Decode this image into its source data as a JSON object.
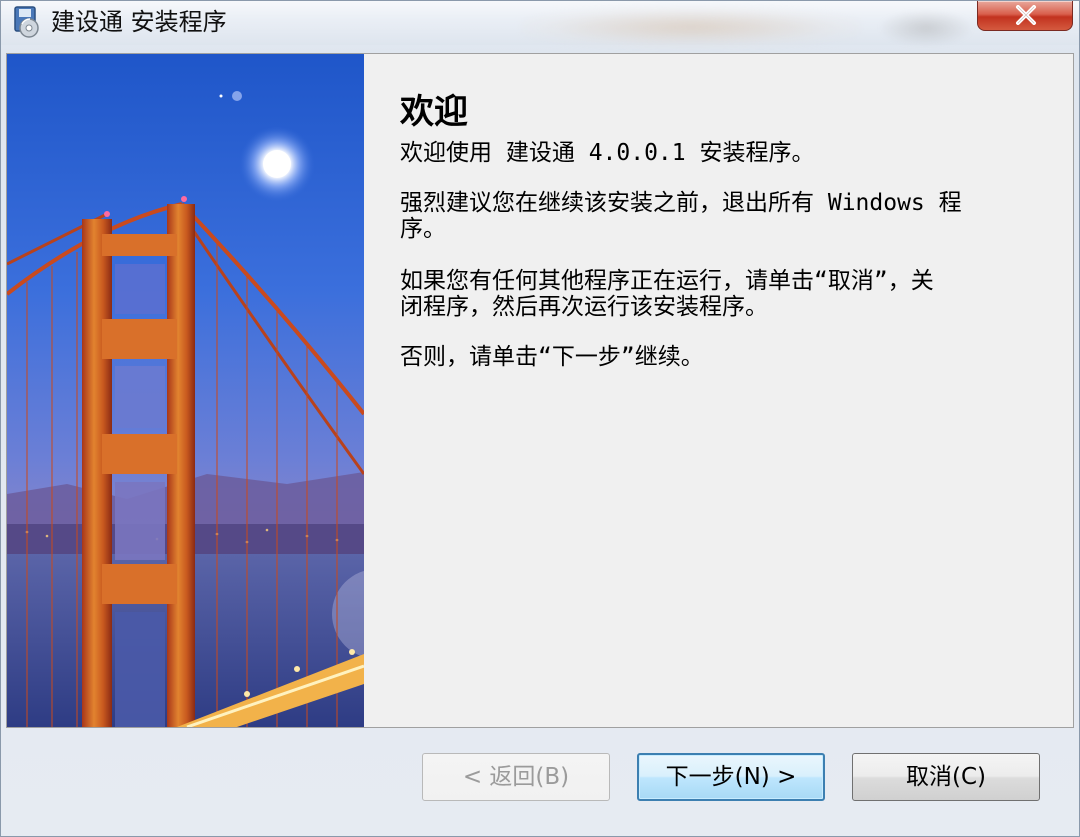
{
  "window": {
    "title": "建设通 安装程序",
    "icon": "installer-disk-icon",
    "close_icon": "close-x-icon",
    "accent_close": "#c7402c"
  },
  "wizard": {
    "heading": "欢迎",
    "paragraphs": [
      "欢迎使用 建设通 4.0.0.1 安装程序。",
      "强烈建议您在继续该安装之前，退出所有 Windows 程\n序。",
      "如果您有任何其他程序正在运行，请单击“取消”，关\n闭程序，然后再次运行该安装程序。",
      "否则，请单击“下一步”继续。"
    ],
    "banner_image": "golden-gate-bridge-illustration"
  },
  "buttons": {
    "back_label": "< 返回(B)",
    "next_label": "下一步(N) >",
    "cancel_label": "取消(C)",
    "focused_border": "#3c7fb1"
  }
}
